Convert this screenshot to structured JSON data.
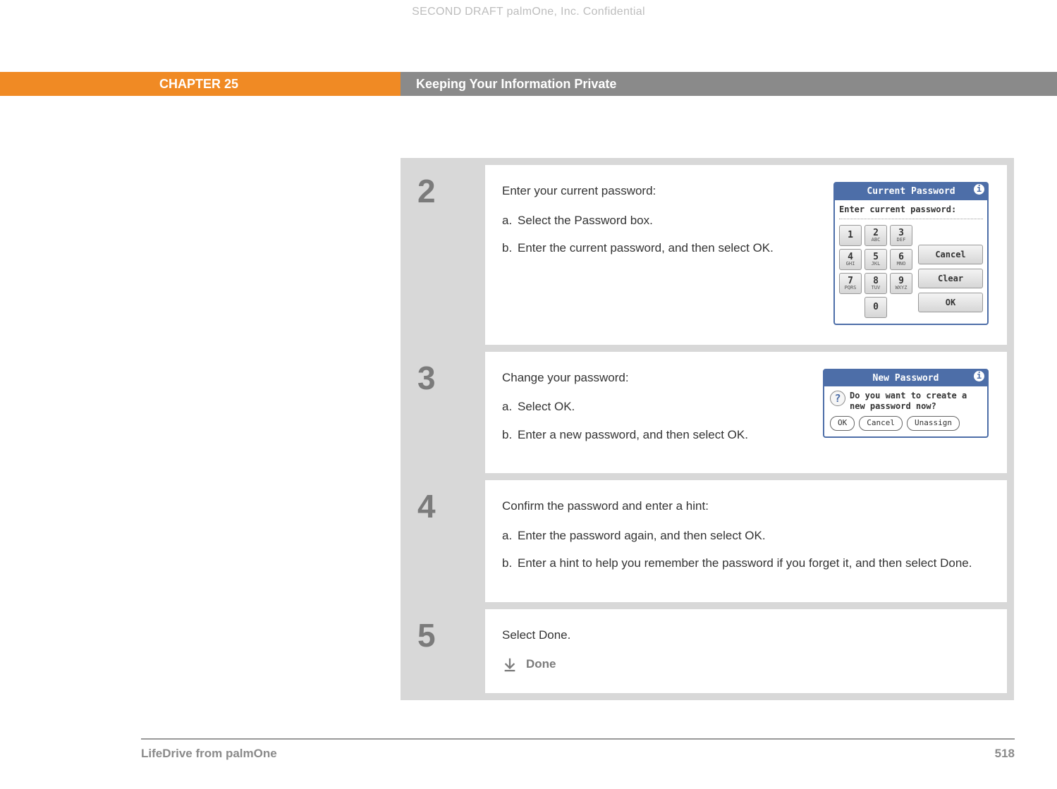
{
  "watermark": "SECOND DRAFT palmOne, Inc.  Confidential",
  "header": {
    "chapter": "CHAPTER 25",
    "title": "Keeping Your Information Private"
  },
  "steps": [
    {
      "num": "2",
      "lead": "Enter your current password:",
      "subs": [
        {
          "label": "a.",
          "text": "Select the Password box."
        },
        {
          "label": "b.",
          "text": "Enter the current password, and then select OK."
        }
      ],
      "device1": {
        "title": "Current Password",
        "prompt": "Enter current password:",
        "keys": [
          {
            "n": "1",
            "l": ""
          },
          {
            "n": "2",
            "l": "ABC"
          },
          {
            "n": "3",
            "l": "DEF"
          },
          {
            "n": "4",
            "l": "GHI"
          },
          {
            "n": "5",
            "l": "JKL"
          },
          {
            "n": "6",
            "l": "MNO"
          },
          {
            "n": "7",
            "l": "PQRS"
          },
          {
            "n": "8",
            "l": "TUV"
          },
          {
            "n": "9",
            "l": "WXYZ"
          },
          {
            "n": "0",
            "l": ""
          }
        ],
        "side": [
          "Cancel",
          "Clear",
          "OK"
        ]
      }
    },
    {
      "num": "3",
      "lead": "Change your password:",
      "subs": [
        {
          "label": "a.",
          "text": "Select OK."
        },
        {
          "label": "b.",
          "text": "Enter a new password, and then select OK."
        }
      ],
      "device2": {
        "title": "New Password",
        "question": "Do you want to create a new password now?",
        "buttons": [
          "OK",
          "Cancel",
          "Unassign"
        ]
      }
    },
    {
      "num": "4",
      "lead": "Confirm the password and enter a hint:",
      "subs": [
        {
          "label": "a.",
          "text": "Enter the password again, and then select OK."
        },
        {
          "label": "b.",
          "text": "Enter a hint to help you remember the password if you forget it, and then select Done."
        }
      ]
    },
    {
      "num": "5",
      "lead": "Select Done.",
      "done": "Done"
    }
  ],
  "footer": {
    "product": "LifeDrive from palmOne",
    "page": "518"
  }
}
